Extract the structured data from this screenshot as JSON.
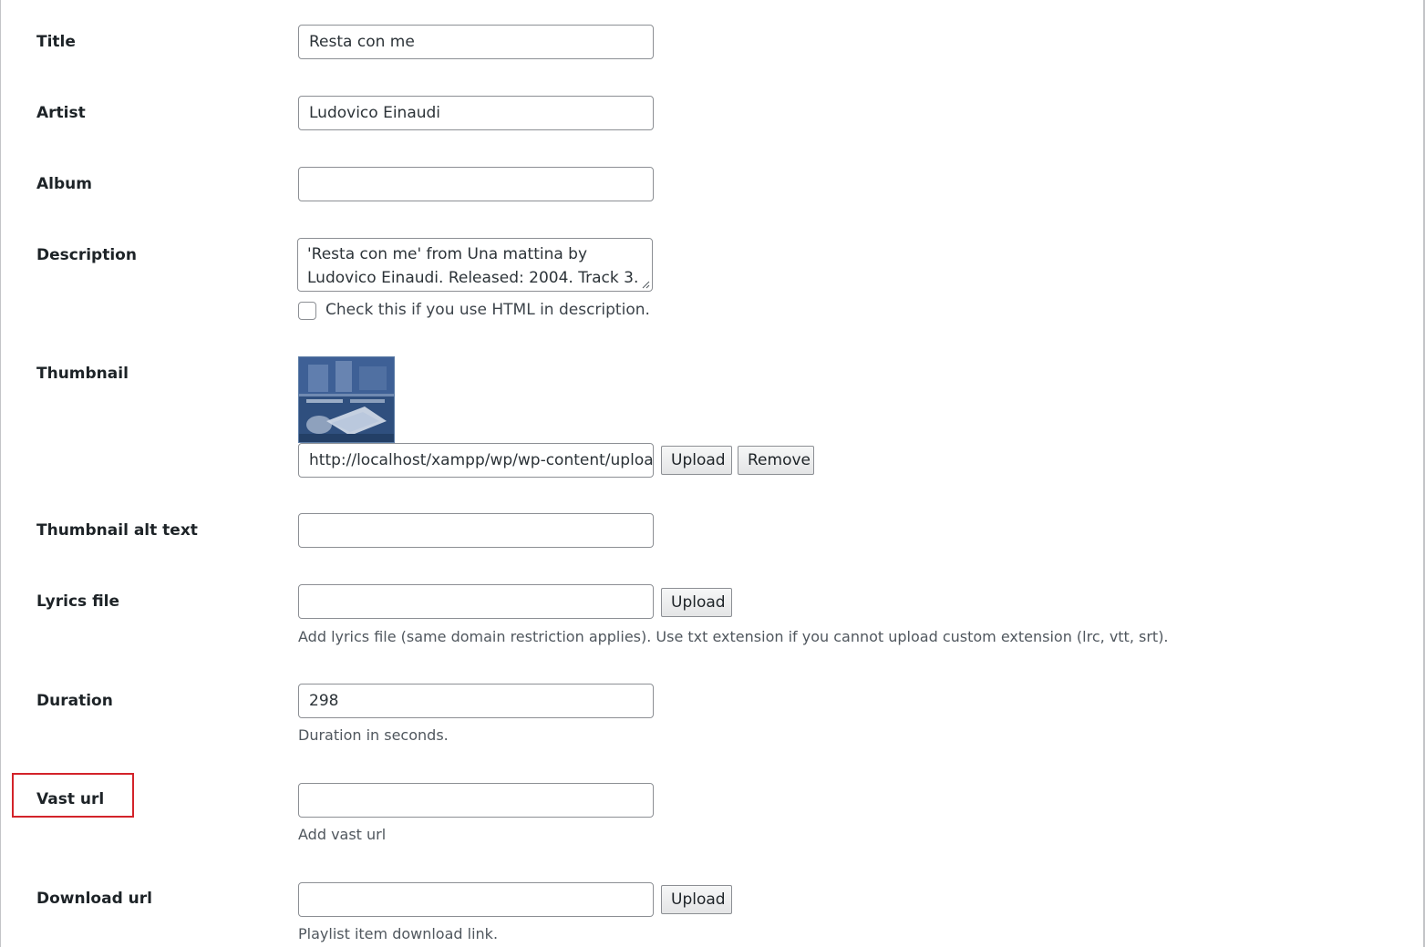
{
  "fields": {
    "title": {
      "label": "Title",
      "value": "Resta con me"
    },
    "artist": {
      "label": "Artist",
      "value": "Ludovico Einaudi"
    },
    "album": {
      "label": "Album",
      "value": ""
    },
    "description": {
      "label": "Description",
      "value": "'Resta con me' from Una mattina by Ludovico Einaudi. Released: 2004. Track 3.",
      "html_checkbox_label": "Check this if you use HTML in description.",
      "html_checked": false
    },
    "thumbnail": {
      "label": "Thumbnail",
      "value": "http://localhost/xampp/wp/wp-content/uploa",
      "upload_label": "Upload",
      "remove_label": "Remove"
    },
    "thumbnail_alt": {
      "label": "Thumbnail alt text",
      "value": ""
    },
    "lyrics": {
      "label": "Lyrics file",
      "value": "",
      "upload_label": "Upload",
      "help": "Add lyrics file (same domain restriction applies). Use txt extension if you cannot upload custom extension (lrc, vtt, srt)."
    },
    "duration": {
      "label": "Duration",
      "value": "298",
      "help": "Duration in seconds."
    },
    "vast_url": {
      "label": "Vast url",
      "value": "",
      "help": "Add vast url"
    },
    "download_url": {
      "label": "Download url",
      "value": "",
      "upload_label": "Upload",
      "help": "Playlist item download link."
    }
  },
  "colors": {
    "highlight_border": "#d3232a",
    "input_border": "#8c8f94",
    "label_text": "#1d2327",
    "help_text": "#50575e"
  }
}
